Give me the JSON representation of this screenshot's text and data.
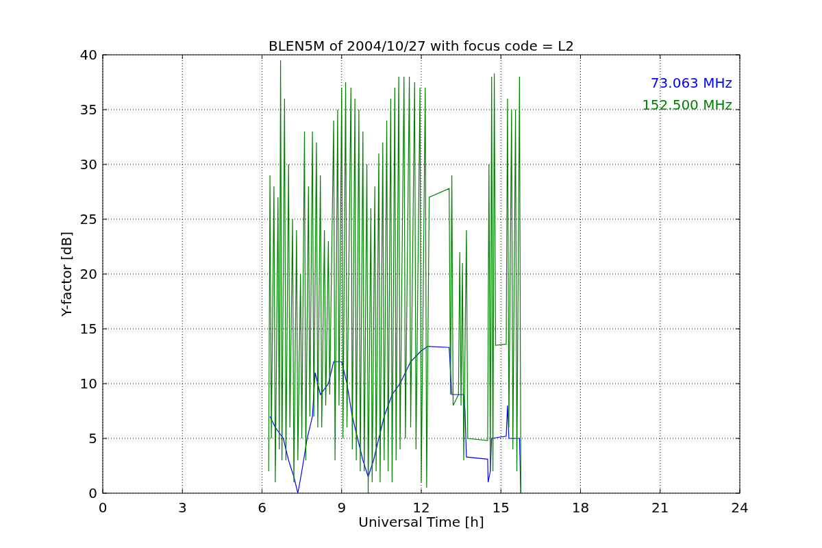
{
  "chart_data": {
    "type": "line",
    "grid": true,
    "title": "BLEN5M of 2004/10/27 with focus code = L2",
    "xlabel": "Universal Time [h]",
    "ylabel": "Y-factor [dB]",
    "xlim": [
      0,
      24
    ],
    "ylim": [
      0,
      40
    ],
    "xticks": [
      0,
      3,
      6,
      9,
      12,
      15,
      18,
      21,
      24
    ],
    "yticks": [
      0,
      5,
      10,
      15,
      20,
      25,
      30,
      35,
      40
    ],
    "series": [
      {
        "name": "73.063 MHz",
        "color": "#0000ff",
        "x": [
          6.3,
          6.5,
          6.8,
          7.0,
          7.2,
          7.35,
          7.5,
          7.7,
          7.9,
          8.0,
          8.2,
          8.5,
          8.7,
          9.0,
          9.2,
          9.4,
          9.6,
          9.8,
          10.0,
          10.2,
          10.4,
          10.6,
          10.9,
          11.2,
          11.6,
          12.0,
          12.25,
          13.05,
          13.15,
          13.6,
          13.65,
          13.7,
          14.5,
          14.52,
          14.6,
          14.65,
          15.2,
          15.25,
          15.3,
          15.7,
          15.75
        ],
        "values": [
          7,
          6,
          5,
          3,
          1.5,
          0,
          2,
          5,
          7,
          11,
          9,
          10,
          12,
          12,
          10,
          7,
          5,
          3,
          1.5,
          3,
          5,
          7,
          9,
          10,
          12,
          13,
          13.4,
          13.3,
          9,
          9,
          7.5,
          3.3,
          3.1,
          1,
          2,
          5,
          5.2,
          8,
          5,
          5,
          0
        ]
      },
      {
        "name": "152.500 MHz",
        "color": "#008000",
        "x": [
          6.25,
          6.3,
          6.35,
          6.45,
          6.5,
          6.6,
          6.65,
          6.7,
          6.75,
          6.85,
          6.9,
          7.0,
          7.05,
          7.15,
          7.2,
          7.3,
          7.35,
          7.45,
          7.5,
          7.6,
          7.65,
          7.75,
          7.8,
          7.9,
          7.95,
          8.05,
          8.1,
          8.2,
          8.25,
          8.35,
          8.4,
          8.5,
          8.55,
          8.7,
          8.75,
          8.85,
          8.9,
          9.0,
          9.05,
          9.15,
          9.2,
          9.35,
          9.4,
          9.5,
          9.55,
          9.65,
          9.7,
          9.8,
          9.85,
          9.95,
          10.0,
          10.1,
          10.15,
          10.25,
          10.3,
          10.4,
          10.45,
          10.55,
          10.6,
          10.7,
          10.75,
          10.85,
          10.9,
          11.0,
          11.05,
          11.15,
          11.2,
          11.35,
          11.4,
          11.55,
          11.6,
          11.75,
          11.8,
          11.95,
          12.0,
          12.15,
          12.2,
          12.3,
          13.05,
          13.1,
          13.15,
          13.2,
          13.3,
          13.4,
          13.45,
          13.5,
          13.55,
          13.6,
          13.7,
          13.75,
          14.5,
          14.55,
          14.6,
          14.65,
          14.7,
          14.75,
          14.8,
          15.2,
          15.25,
          15.3,
          15.4,
          15.45,
          15.55,
          15.6,
          15.7,
          15.75
        ],
        "values": [
          2,
          29,
          5,
          28,
          1,
          27,
          4,
          39.5,
          3,
          36,
          3,
          30,
          6,
          25,
          1,
          24,
          3,
          20,
          5,
          33,
          3,
          28,
          7,
          33,
          7,
          32,
          6,
          29,
          6,
          24,
          8,
          23,
          9,
          34,
          3,
          35,
          8,
          37,
          5,
          37.5,
          6,
          37,
          4,
          36,
          3,
          35,
          2,
          33,
          2,
          30,
          0,
          26,
          1,
          28,
          2,
          31,
          1,
          32,
          3,
          34,
          2,
          36,
          1,
          37,
          3,
          38,
          4,
          38,
          5,
          38,
          6,
          37.5,
          4,
          37,
          1,
          37,
          0.5,
          27,
          27.8,
          9,
          29,
          8,
          8.5,
          9,
          22,
          8,
          21,
          3,
          24,
          5,
          4.8,
          30,
          2,
          38,
          2,
          38.3,
          13.5,
          13.6,
          36,
          6,
          35,
          4,
          35,
          2,
          38,
          0
        ]
      }
    ]
  }
}
